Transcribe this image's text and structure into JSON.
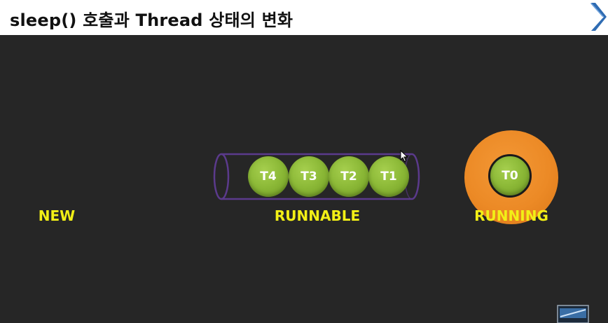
{
  "slide": {
    "title": "sleep() 호출과 Thread 상태의 변화"
  },
  "states": {
    "new_label": "NEW",
    "runnable_label": "RUNNABLE",
    "running_label": "RUNNING"
  },
  "runnable_queue": [
    "T4",
    "T3",
    "T2",
    "T1"
  ],
  "running_thread": "T0",
  "colors": {
    "background": "#262626",
    "header": "#ffffff",
    "thread_ball": "#8dba38",
    "running_disc": "#ec8a26",
    "state_label": "#f2ef16",
    "tube_outline": "#5b3a8c",
    "next_arrow": "#2f6cb3"
  },
  "icons": {
    "next": "chevron-right-icon",
    "cursor": "mouse-cursor-icon",
    "thumbnail": "window-thumbnail-icon"
  }
}
